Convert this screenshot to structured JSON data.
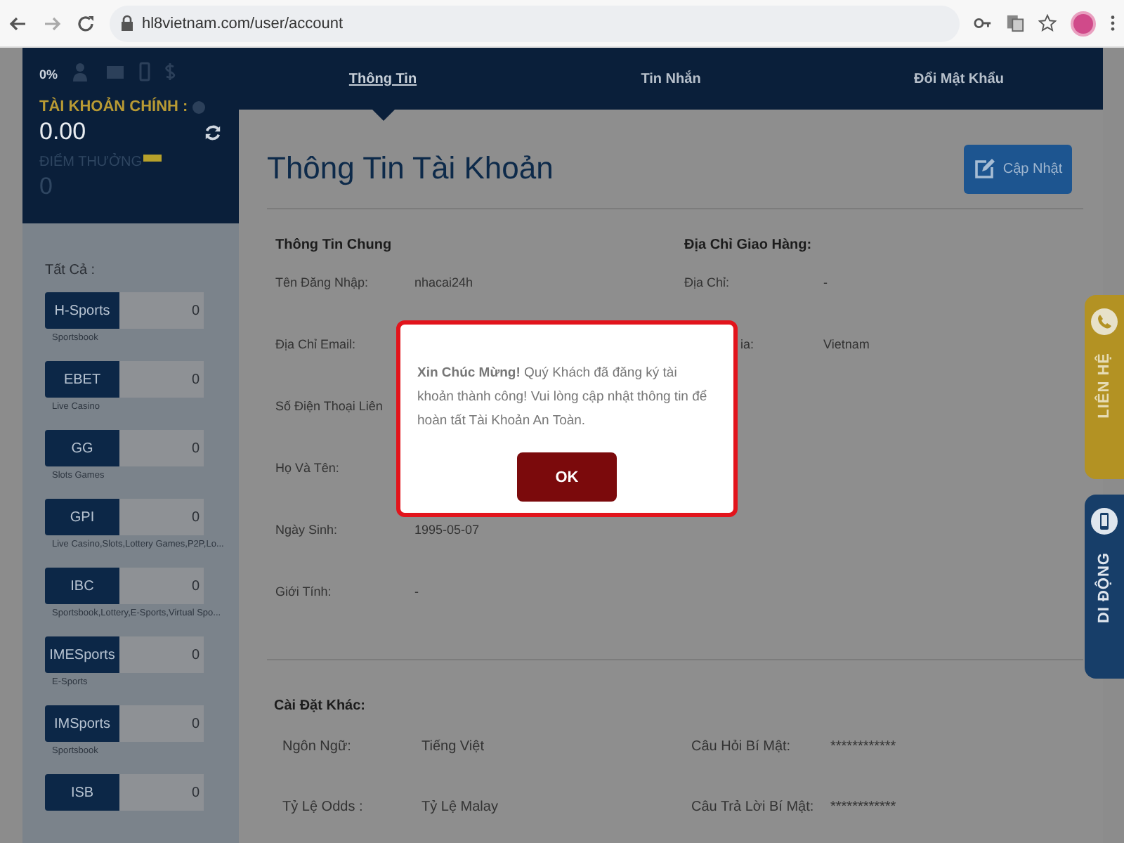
{
  "browser": {
    "url": "hl8vietnam.com/user/account"
  },
  "account": {
    "progress": "0%",
    "balance_label": "TÀI KHOẢN CHÍNH :",
    "balance": "0.00",
    "points_label": "ĐIỂM THƯỞNG",
    "points": "0"
  },
  "products": {
    "heading": "Tất Cả :",
    "items": [
      {
        "name": "H-Sports",
        "amount": "0",
        "category": "Sportsbook"
      },
      {
        "name": "EBET",
        "amount": "0",
        "category": "Live Casino"
      },
      {
        "name": "GG",
        "amount": "0",
        "category": "Slots Games"
      },
      {
        "name": "GPI",
        "amount": "0",
        "category": "Live Casino,Slots,Lottery Games,P2P,Lo..."
      },
      {
        "name": "IBC",
        "amount": "0",
        "category": "Sportsbook,Lottery,E-Sports,Virtual Spo..."
      },
      {
        "name": "IMESports",
        "amount": "0",
        "category": "E-Sports"
      },
      {
        "name": "IMSports",
        "amount": "0",
        "category": "Sportsbook"
      },
      {
        "name": "ISB",
        "amount": "0"
      }
    ]
  },
  "tabs": [
    {
      "label": "Thông Tin",
      "selected": true
    },
    {
      "label": "Tin Nhắn",
      "selected": false
    },
    {
      "label": "Đổi Mật Khẩu",
      "selected": false
    }
  ],
  "page": {
    "title": "Thông Tin Tài Khoản",
    "update_button": "Cập Nhật"
  },
  "general": {
    "heading": "Thông Tin Chung",
    "rows": [
      {
        "label": "Tên Đăng Nhập:",
        "value": "nhacai24h"
      },
      {
        "label": "Địa Chỉ Email:"
      },
      {
        "label": "Số Điện Thoại Liên"
      },
      {
        "label": "Họ Và Tên:"
      },
      {
        "label": "Ngày Sinh:",
        "value": "1995-05-07"
      },
      {
        "label": "Giới Tính:",
        "value": "-"
      }
    ]
  },
  "shipping": {
    "heading": "Địa Chỉ Giao Hàng:",
    "rows": [
      {
        "label": "Địa Chỉ:",
        "value": "-",
        "clipped": false
      },
      {
        "label": "ia:",
        "value": "Vietnam",
        "clipped": true
      }
    ]
  },
  "other": {
    "heading": "Cài Đặt Khác:",
    "rows": [
      {
        "label": "Ngôn Ngữ:",
        "value": "Tiếng Việt"
      },
      {
        "label": "Câu Hỏi Bí Mật:",
        "value": "************"
      },
      {
        "label": "Tỷ Lệ Odds :",
        "value": "Tỷ Lệ Malay"
      },
      {
        "label": "Câu Trả Lời Bí Mật:",
        "value": "************"
      }
    ]
  },
  "dialog": {
    "message": "**Xin Chúc Mừng!** Quý Khách đã đăng ký tài khoản thành công! Vui lòng cập nhật thông tin để hoàn tất Tài Khoản An Toàn.",
    "button": "OK"
  },
  "side_tabs": [
    {
      "label": "LIÊN HỆ",
      "kind": "contact"
    },
    {
      "label": "DI ĐỘNG",
      "kind": "mobile"
    }
  ]
}
